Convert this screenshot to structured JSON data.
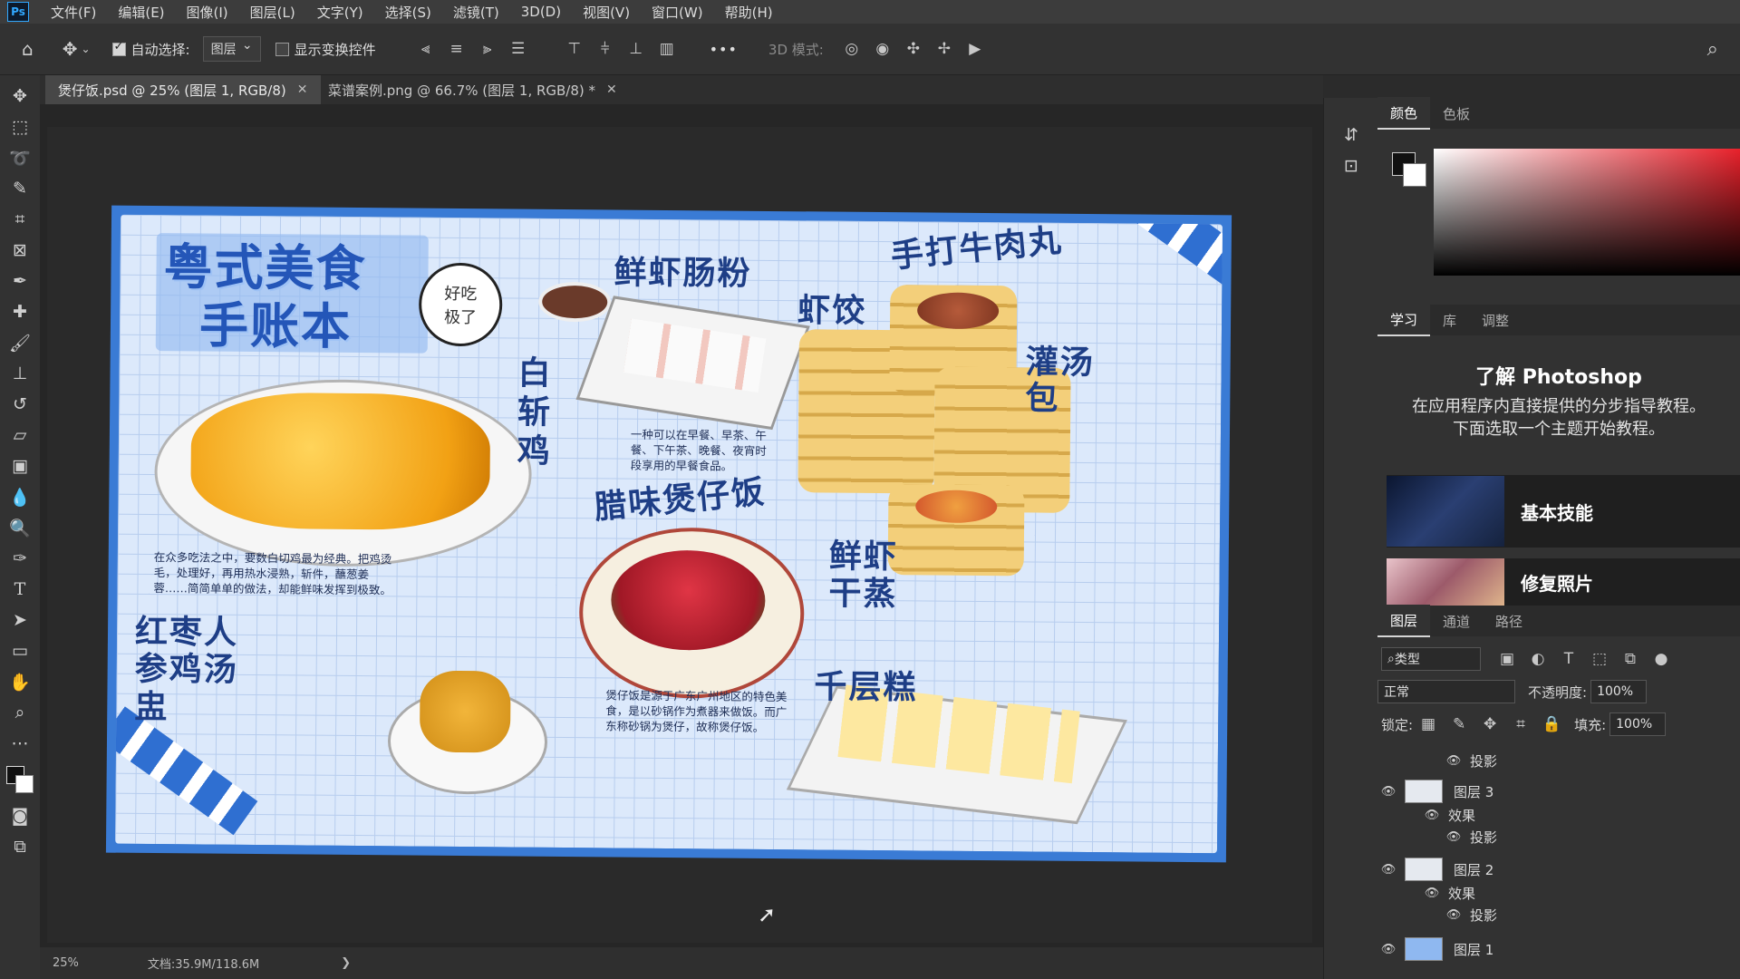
{
  "menu": {
    "logo": "Ps",
    "items": [
      "文件(F)",
      "编辑(E)",
      "图像(I)",
      "图层(L)",
      "文字(Y)",
      "选择(S)",
      "滤镜(T)",
      "3D(D)",
      "视图(V)",
      "窗口(W)",
      "帮助(H)"
    ]
  },
  "options": {
    "auto_select_label": "自动选择:",
    "auto_select_value": "图层",
    "show_transform_label": "显示变换控件",
    "more": "•••",
    "mode3d_label": "3D 模式:"
  },
  "tabs": [
    {
      "label": "煲仔饭.psd @ 25% (图层 1, RGB/8)",
      "active": true
    },
    {
      "label": "菜谱案例.png @ 66.7% (图层 1, RGB/8) *",
      "active": false
    }
  ],
  "artwork": {
    "main_title_line1": "粤式美食",
    "main_title_line2": "手账本",
    "speech": "好吃\n极了",
    "shrimp_roll": "鲜虾肠粉",
    "beef_balls": "手打牛肉丸",
    "har_gow": "虾饺",
    "chicken": "白斩鸡",
    "soup_bun": "灌汤包",
    "breakfast_desc": "一种可以在早餐、早茶、午餐、下午茶、晚餐、夜宵时段享用的早餐食品。",
    "claypot": "腊味煲仔饭",
    "shrimp_steam": "鲜虾干蒸",
    "chicken_desc": "在众多吃法之中，要数白切鸡最为经典。把鸡烫毛，处理好，再用热水浸熟，斩件，蘸葱姜蓉……简简单单的做法，却能鲜味发挥到极致。",
    "red_date": "红枣人参鸡汤盅",
    "claypot_desc": "煲仔饭是源于广东广州地区的特色美食，是以砂锅作为煮器来做饭。而广东称砂锅为煲仔，故称煲仔饭。",
    "layer_cake": "千层糕"
  },
  "right_panel": {
    "color_tabs": [
      "颜色",
      "色板"
    ],
    "learn_tabs": [
      "学习",
      "库",
      "调整"
    ],
    "learn_title": "了解 Photoshop",
    "learn_desc": "在应用程序内直接提供的分步指导教程。\n下面选取一个主题开始教程。",
    "cards": [
      "基本技能",
      "修复照片"
    ],
    "layer_tabs": [
      "图层",
      "通道",
      "路径"
    ],
    "filter_type": "类型",
    "blend_mode": "正常",
    "opacity_label": "不透明度:",
    "opacity_value": "100%",
    "lock_label": "锁定:",
    "fill_label": "填充:",
    "fill_value": "100%",
    "layers": [
      {
        "label": "投影",
        "kind": "effect-item"
      },
      {
        "label": "图层 3",
        "kind": "layer"
      },
      {
        "label": "效果",
        "kind": "effects"
      },
      {
        "label": "投影",
        "kind": "effect-item"
      },
      {
        "label": "图层 2",
        "kind": "layer"
      },
      {
        "label": "效果",
        "kind": "effects"
      },
      {
        "label": "投影",
        "kind": "effect-item"
      },
      {
        "label": "图层 1",
        "kind": "layer"
      }
    ]
  },
  "status": {
    "zoom": "25%",
    "doc": "文档:35.9M/118.6M",
    "arrow": "❯"
  },
  "colors": {
    "accent_red": "#e8202a",
    "brand_blue": "#31a8ff"
  }
}
